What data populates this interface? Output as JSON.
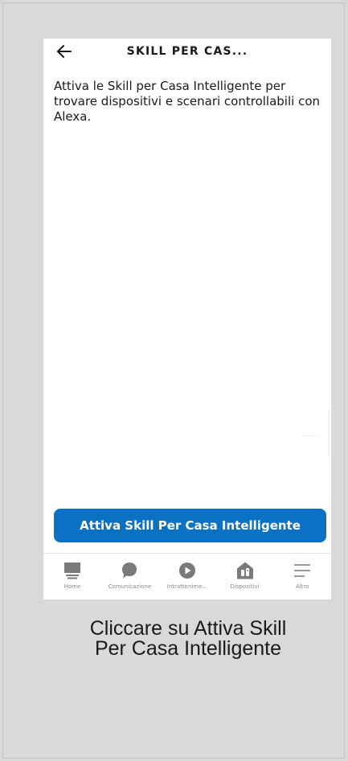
{
  "header": {
    "title": "SKILL PER CAS..."
  },
  "main": {
    "description": "Attiva le Skill per Casa Intelligente per trovare dispositivi e scenari controllabili con Alexa.",
    "cta_label": "Attiva Skill Per Casa Intelligente"
  },
  "nav": {
    "items": [
      {
        "label": "Home",
        "icon": "home-icon"
      },
      {
        "label": "Comunicazione",
        "icon": "chat-bubble-icon"
      },
      {
        "label": "Intrattenime...",
        "icon": "play-icon"
      },
      {
        "label": "Dispositivi",
        "icon": "devices-house-icon"
      },
      {
        "label": "Altro",
        "icon": "menu-lines-icon"
      }
    ]
  },
  "caption": {
    "line1": "Cliccare su Attiva Skill",
    "line2": "Per Casa Intelligente"
  },
  "colors": {
    "accent": "#0b71c4",
    "background": "#d9d9d9",
    "icon_gray": "#7a7a7a"
  }
}
